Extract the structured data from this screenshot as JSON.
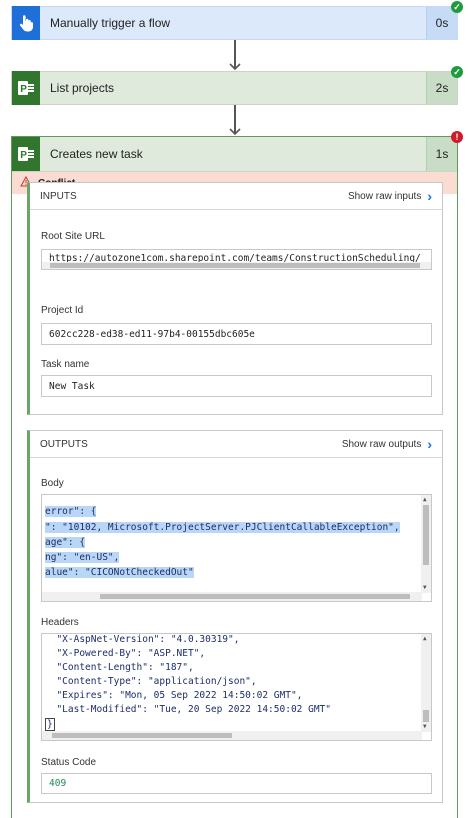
{
  "steps": [
    {
      "title": "Manually trigger a flow",
      "duration": "0s",
      "status": "succeeded"
    },
    {
      "title": "List projects",
      "duration": "2s",
      "status": "succeeded"
    },
    {
      "title": "Creates new task",
      "duration": "1s",
      "status": "failed"
    }
  ],
  "error_banner": "Conflict.",
  "inputs": {
    "heading": "INPUTS",
    "raw_link": "Show raw inputs",
    "root_site_label": "Root Site URL",
    "root_site_value": "https://autozone1com.sharepoint.com/teams/ConstructionScheduling/",
    "project_id_label": "Project Id",
    "project_id_value": "602cc228-ed38-ed11-97b4-00155dbc605e",
    "task_name_label": "Task name",
    "task_name_value": "New Task"
  },
  "outputs": {
    "heading": "OUTPUTS",
    "raw_link": "Show raw outputs",
    "body_label": "Body",
    "body_lines": [
      "error\": {",
      "\": \"10102, Microsoft.ProjectServer.PJClientCallableException\",",
      "age\": {",
      "ng\": \"en-US\",",
      "alue\": \"CICONotCheckedOut\""
    ],
    "headers_label": "Headers",
    "headers_lines": [
      "  \"X-AspNet-Version\": \"4.0.30319\",",
      "  \"X-Powered-By\": \"ASP.NET\",",
      "  \"Content-Length\": \"187\",",
      "  \"Content-Type\": \"application/json\",",
      "  \"Expires\": \"Mon, 05 Sep 2022 14:50:02 GMT\",",
      "  \"Last-Modified\": \"Tue, 20 Sep 2022 14:50:02 GMT\"",
      "}"
    ],
    "status_code_label": "Status Code",
    "status_code_value": "409"
  },
  "colors": {
    "trigger_accent": "#1f6fd8",
    "project_accent": "#31752f",
    "success": "#1e9c3c",
    "error": "#d0192b",
    "error_banner_bg": "#fbdcd3"
  }
}
